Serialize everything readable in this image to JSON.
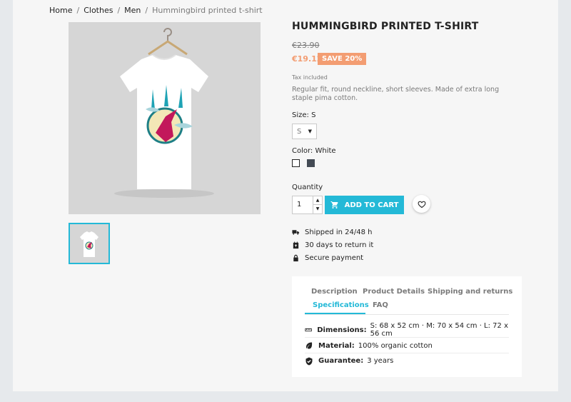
{
  "breadcrumb": [
    "Home",
    "Clothes",
    "Men",
    "Hummingbird printed t-shirt"
  ],
  "breadcrumb_separator": "/",
  "product": {
    "title": "HUMMINGBIRD PRINTED T-SHIRT",
    "old_price": "€23.90",
    "price": "€19.12",
    "discount": "SAVE 20%",
    "tax": "Tax included",
    "description": "Regular fit, round neckline, short sleeves. Made of extra long staple pima cotton."
  },
  "size": {
    "label": "Size: S",
    "value": "S"
  },
  "color": {
    "label": "Color: White",
    "swatches": [
      "white",
      "grey"
    ]
  },
  "quantity": {
    "label": "Quantity",
    "value": "1"
  },
  "add_to_cart": "ADD TO CART",
  "reassurance": [
    {
      "icon": "truck-icon",
      "text": "Shipped in 24/48 h"
    },
    {
      "icon": "calendar-return-icon",
      "text": "30 days to return it"
    },
    {
      "icon": "lock-icon",
      "text": "Secure payment"
    }
  ],
  "tabs": [
    "Description",
    "Product Details",
    "Shipping and returns",
    "Specifications",
    "FAQ"
  ],
  "active_tab": "Specifications",
  "specs": [
    {
      "icon": "ruler-icon",
      "label": "Dimensions:",
      "value": "S: 68 x 52 cm  ·  M: 70 x 54 cm  ·  L: 72 x 56 cm"
    },
    {
      "icon": "leaf-icon",
      "label": "Material:",
      "value": "100% organic cotton"
    },
    {
      "icon": "shield-check-icon",
      "label": "Guarantee:",
      "value": "3 years"
    }
  ],
  "colors": {
    "accent": "#24b9d7",
    "sale": "#f39d72",
    "text": "#232323",
    "muted": "#7a7a7a"
  }
}
